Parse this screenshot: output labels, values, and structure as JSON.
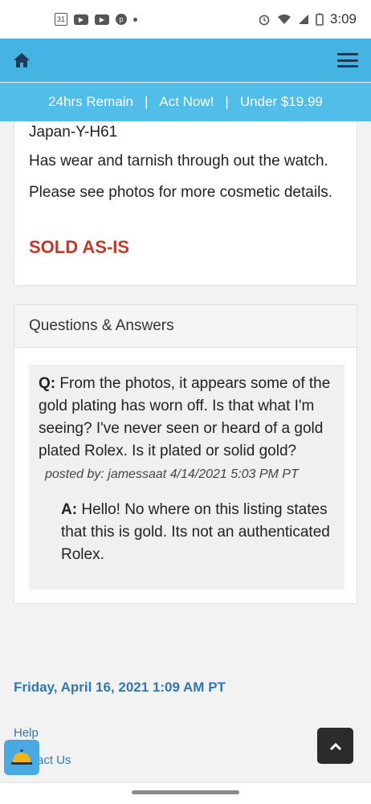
{
  "status_bar": {
    "time": "3:09",
    "calendar_day": "31",
    "icons": [
      "calendar-icon",
      "youtube-icon",
      "youtube-icon",
      "pinterest-icon",
      "dot-icon",
      "alarm-icon",
      "wifi-icon",
      "signal-icon",
      "battery-icon"
    ]
  },
  "header": {
    "home_icon": "home-icon",
    "menu_icon": "hamburger-menu-icon"
  },
  "promo": {
    "item1": "24hrs Remain",
    "sep": "|",
    "item2": "Act Now!",
    "item3": "Under $19.99"
  },
  "description": {
    "line1": "Japan-Y-H61",
    "line2": "Has wear and tarnish through out the watch.",
    "line3": "Please see photos for more cosmetic details.",
    "sold_as_is": "SOLD AS-IS"
  },
  "qa": {
    "title": "Questions & Answers",
    "question_prefix": "Q:",
    "question_text": "From the photos, it appears some of the gold plating has worn off. Is that what I'm seeing? I've never seen or heard of a gold plated Rolex. Is it plated or solid gold?",
    "posted_by": "posted by: jamessaat 4/14/2021 5:03 PM PT",
    "answer_prefix": "A:",
    "answer_text": "Hello! No where on this listing states that this is gold. Its not an authenticated Rolex."
  },
  "footer": {
    "datetime": "Friday, April 16, 2021 1:09 AM PT",
    "help": "Help",
    "contact": "act Us"
  },
  "colors": {
    "header_bg": "#46b4e3",
    "promo_bg": "#51bde9",
    "sold_red": "#c0392b",
    "link_blue": "#2f78b5"
  }
}
